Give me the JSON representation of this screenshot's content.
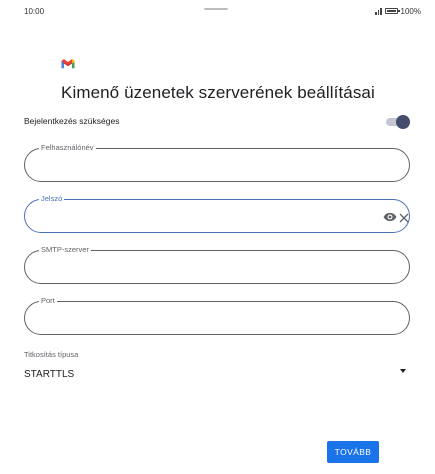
{
  "status_bar": {
    "time": "10:00",
    "battery": "100%"
  },
  "header": {
    "logo_icon": "gmail-logo-icon",
    "title": "Kimenő üzenetek szerverének beállításai"
  },
  "login_required": {
    "label": "Bejelentkezés szükséges",
    "enabled": true
  },
  "fields": {
    "username": {
      "label": "Felhasználónév",
      "value": ""
    },
    "password": {
      "label": "Jelszó",
      "value": "",
      "focused": true
    },
    "smtp_server": {
      "label": "SMTP-szerver",
      "value": ""
    },
    "port": {
      "label": "Port",
      "value": ""
    }
  },
  "encryption": {
    "label": "Titkosítás típusa",
    "selected": "STARTTLS"
  },
  "next_button": {
    "label": "TOVÁBB"
  },
  "colors": {
    "accent": "#1a73e8",
    "focus": "#4a72b8",
    "toggle_knob": "#454d6d"
  }
}
